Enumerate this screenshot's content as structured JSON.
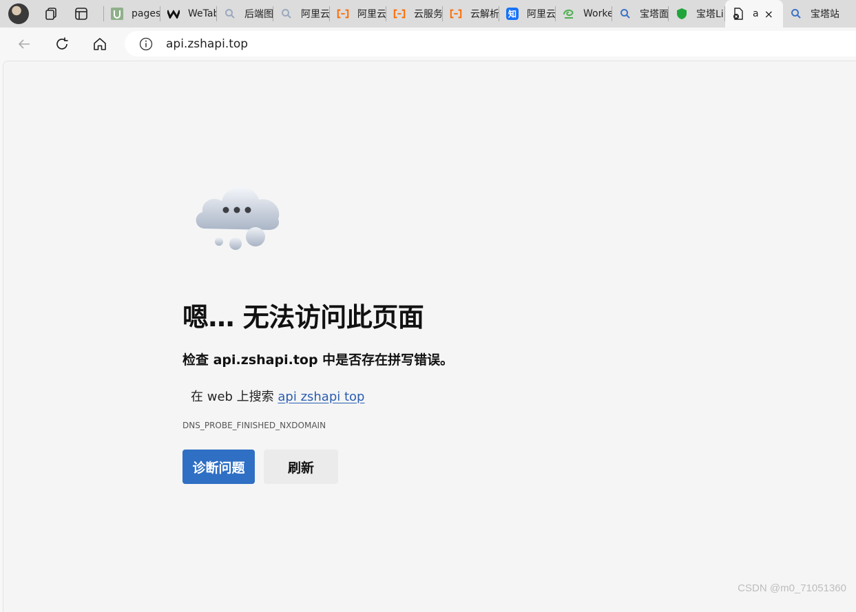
{
  "browser": {
    "tabs": [
      {
        "label": "pages",
        "icon": "upload-tab-icon",
        "color": "#8fb08a"
      },
      {
        "label": "WeTab",
        "icon": "wetab-icon",
        "color": "#111111"
      },
      {
        "label": "后端图",
        "icon": "search-icon",
        "color": "#9aa8bf"
      },
      {
        "label": "阿里云",
        "icon": "search-icon",
        "color": "#9aa8bf"
      },
      {
        "label": "阿里云",
        "icon": "aliyun-icon",
        "color": "#ff6a00"
      },
      {
        "label": "云服务",
        "icon": "aliyun-icon",
        "color": "#ff6a00"
      },
      {
        "label": "云解析",
        "icon": "aliyun-icon",
        "color": "#ff6a00"
      },
      {
        "label": "阿里云",
        "icon": "zhihu-icon",
        "color": "#1772f6"
      },
      {
        "label": "Worke",
        "icon": "worker-icon",
        "color": "#4caf50"
      },
      {
        "label": "宝塔面",
        "icon": "search-icon",
        "color": "#3b73c5"
      },
      {
        "label": "宝塔Li",
        "icon": "shield-icon",
        "color": "#20a53a"
      }
    ],
    "active_tab": {
      "label": "a",
      "close_label": "×"
    },
    "trailing_tab": {
      "label": "宝塔站",
      "icon": "search-icon",
      "color": "#3b73c5"
    },
    "zhihu_glyph": "知",
    "url": "api.zshapi.top"
  },
  "error_page": {
    "title": "嗯… 无法访问此页面",
    "subtitle": "检查 api.zshapi.top 中是否存在拼写错误。",
    "search_prefix": "在 web 上搜索 ",
    "search_link": "api zshapi top",
    "error_code": "DNS_PROBE_FINISHED_NXDOMAIN",
    "diagnose_button": "诊断问题",
    "refresh_button": "刷新"
  },
  "watermark": "CSDN @m0_71051360"
}
